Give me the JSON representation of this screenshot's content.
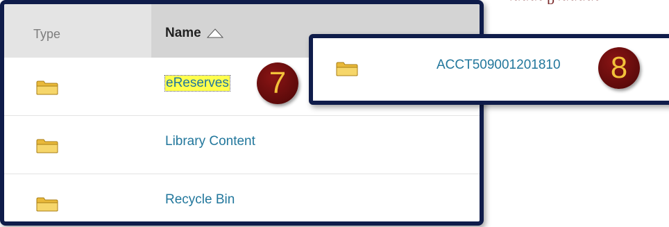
{
  "table": {
    "columns": {
      "type": "Type",
      "name": "Name"
    },
    "rows": [
      {
        "name": "eReserves",
        "icon": "folder-icon",
        "highlighted": true
      },
      {
        "name": "Library Content",
        "icon": "folder-icon"
      },
      {
        "name": "Recycle Bin",
        "icon": "folder-icon"
      }
    ]
  },
  "callout": {
    "name": "ACCT509001201810",
    "icon": "folder-icon"
  },
  "badges": {
    "first": "7",
    "second": "8"
  },
  "colors": {
    "frame": "#0f1c4a",
    "link": "#22779c",
    "highlight": "#ffff4d",
    "badge": "#6e0f0f",
    "badge_text": "#f3c13a",
    "header": "#d4d4d4",
    "folder": "#f2c94c"
  }
}
